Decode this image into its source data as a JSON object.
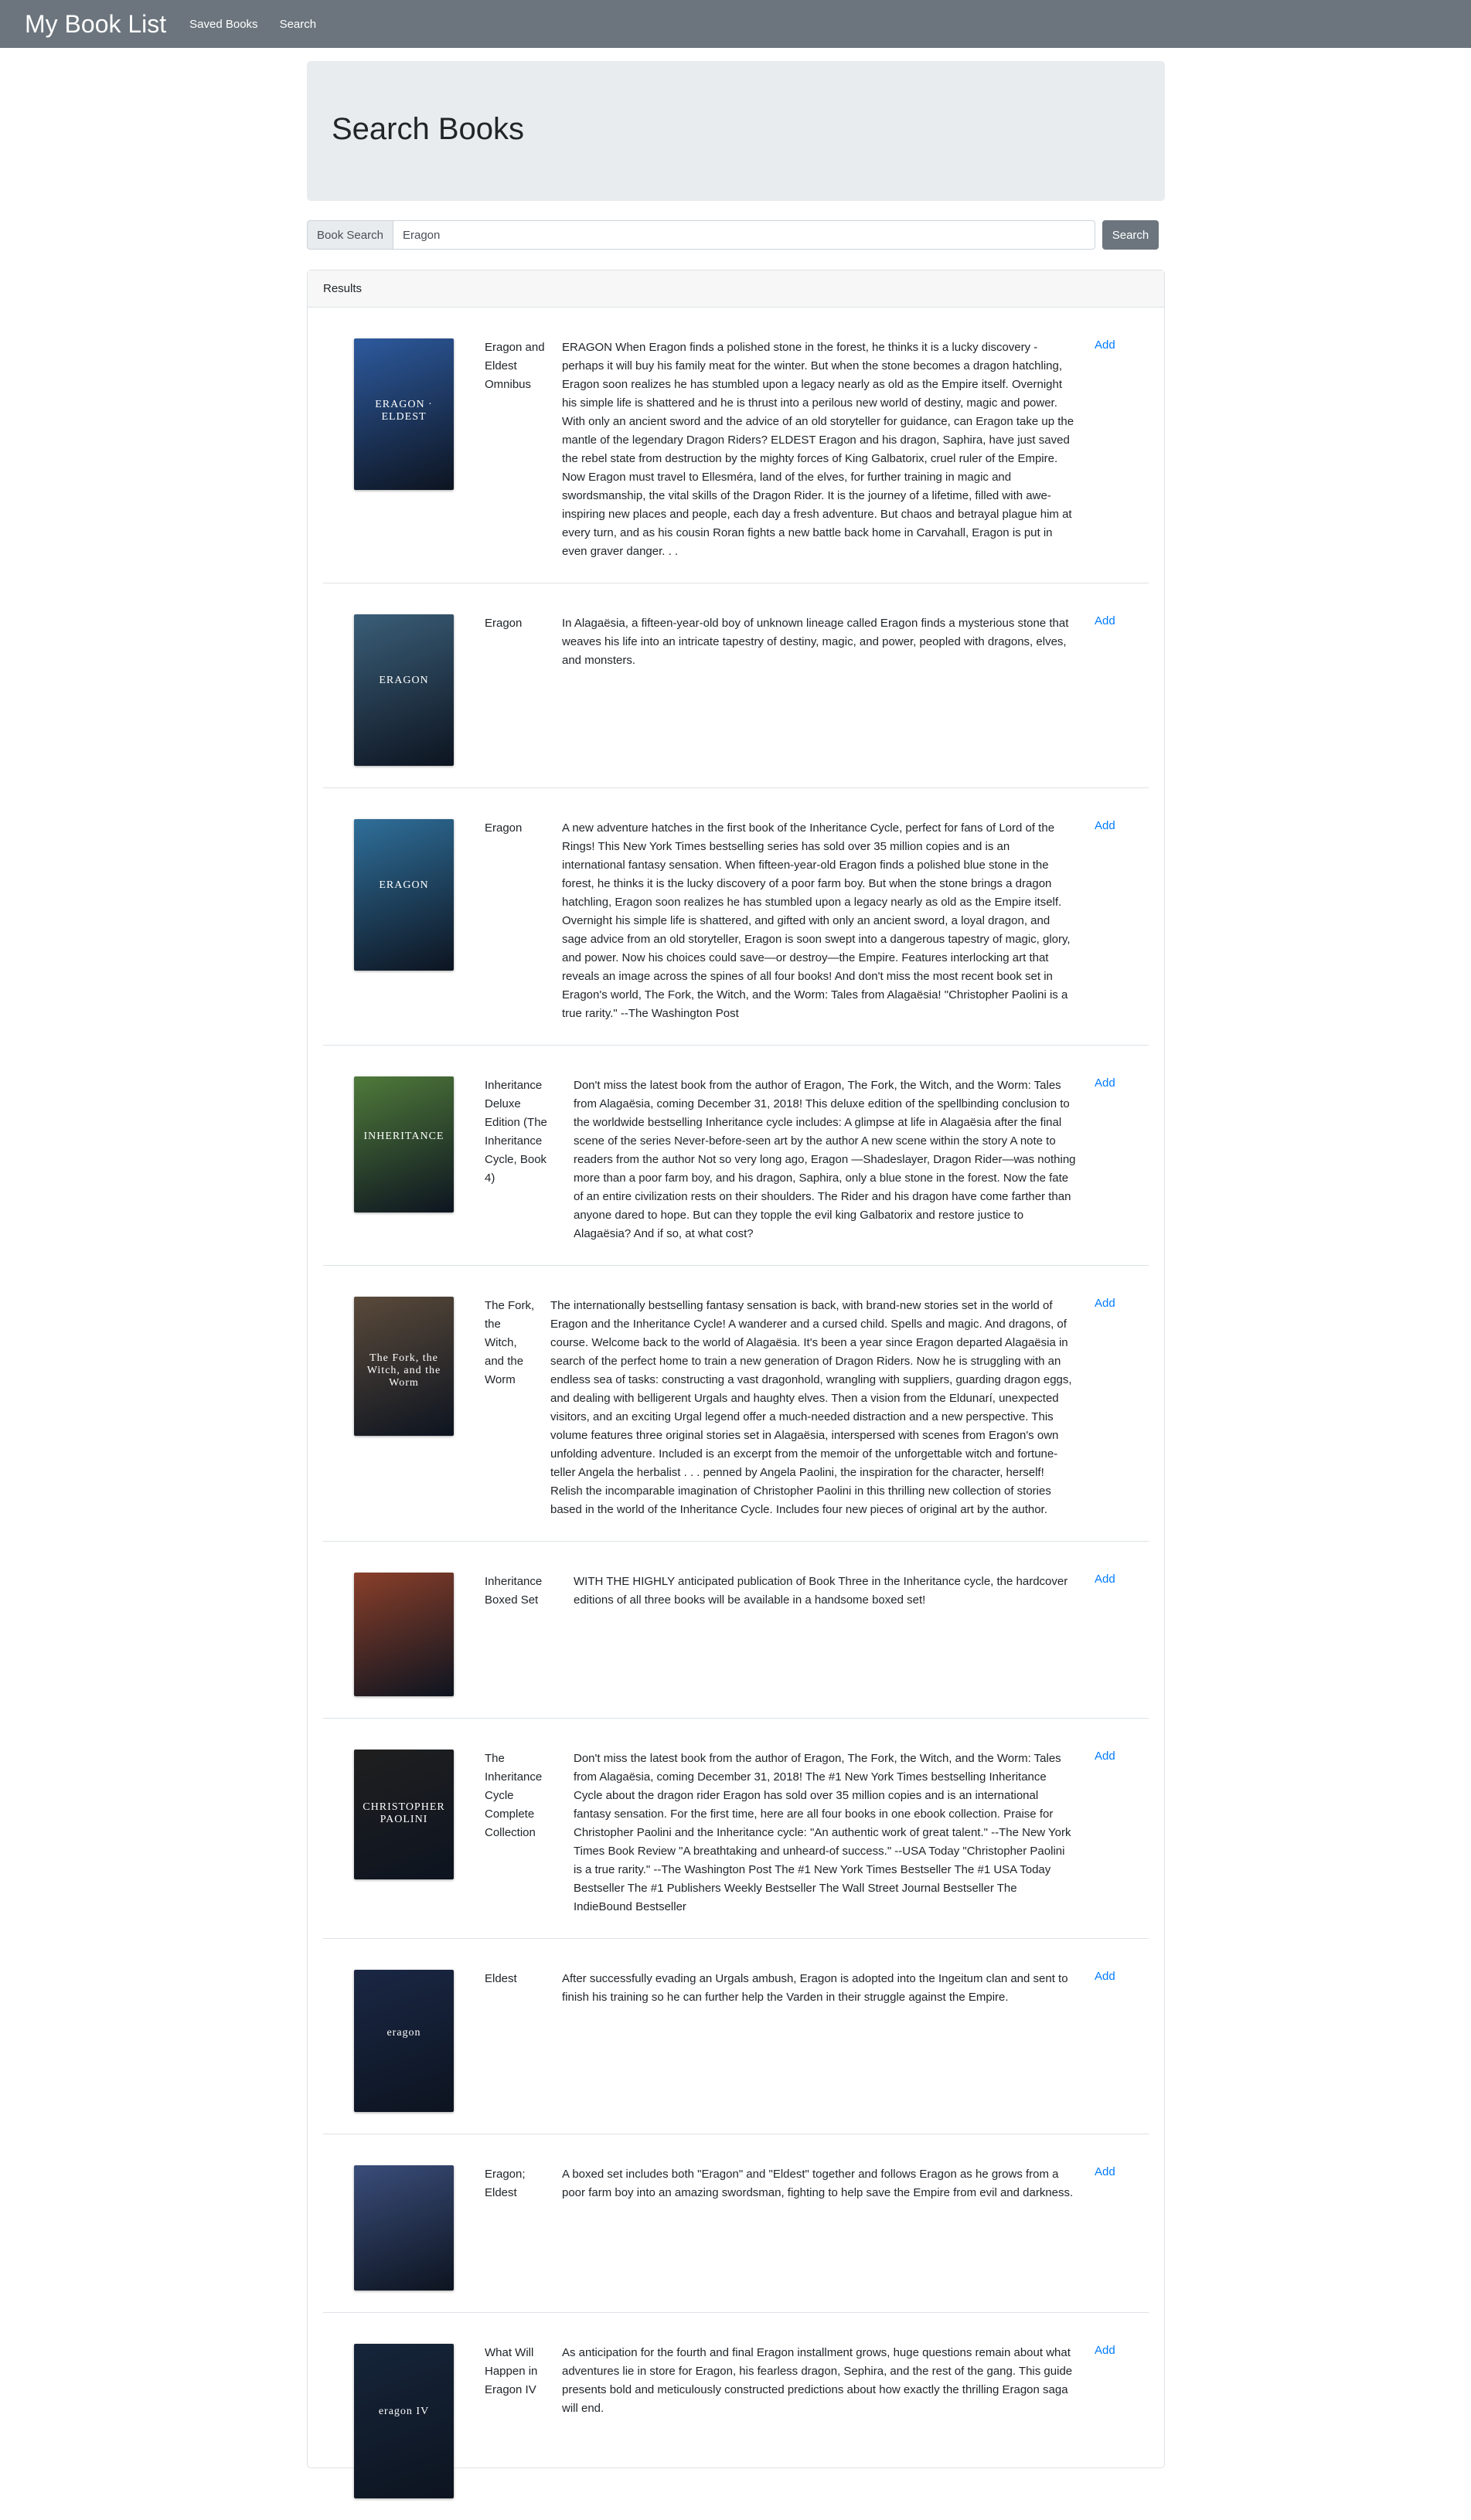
{
  "nav": {
    "brand": "My Book List",
    "links": [
      "Saved Books",
      "Search"
    ]
  },
  "header": {
    "title": "Search Books"
  },
  "search": {
    "label": "Book Search",
    "value": "Eragon",
    "button": "Search"
  },
  "results": {
    "header": "Results",
    "add_label": "Add",
    "items": [
      {
        "title": "Eragon and Eldest Omnibus",
        "cover": {
          "bg": "#2d5a9e",
          "text": "ERAGON · ELDEST"
        },
        "description": "ERAGON When Eragon finds a polished stone in the forest, he thinks it is a lucky discovery - perhaps it will buy his family meat for the winter. But when the stone becomes a dragon hatchling, Eragon soon realizes he has stumbled upon a legacy nearly as old as the Empire itself. Overnight his simple life is shattered and he is thrust into a perilous new world of destiny, magic and power. With only an ancient sword and the advice of an old storyteller for guidance, can Eragon take up the mantle of the legendary Dragon Riders? ELDEST Eragon and his dragon, Saphira, have just saved the rebel state from destruction by the mighty forces of King Galbatorix, cruel ruler of the Empire. Now Eragon must travel to Ellesméra, land of the elves, for further training in magic and swordsmanship, the vital skills of the Dragon Rider. It is the journey of a lifetime, filled with awe-inspiring new places and people, each day a fresh adventure. But chaos and betrayal plague him at every turn, and as his cousin Roran fights a new battle back home in Carvahall, Eragon is put in even graver danger. . ."
      },
      {
        "title": "Eragon",
        "cover": {
          "bg": "#3a5e78",
          "text": "ERAGON"
        },
        "description": "In Alagaësia, a fifteen-year-old boy of unknown lineage called Eragon finds a mysterious stone that weaves his life into an intricate tapestry of destiny, magic, and power, peopled with dragons, elves, and monsters."
      },
      {
        "title": "Eragon",
        "cover": {
          "bg": "#2f6f9a",
          "text": "ERAGON"
        },
        "description": "A new adventure hatches in the first book of the Inheritance Cycle, perfect for fans of Lord of the Rings! This New York Times bestselling series has sold over 35 million copies and is an international fantasy sensation. When fifteen-year-old Eragon finds a polished blue stone in the forest, he thinks it is the lucky discovery of a poor farm boy. But when the stone brings a dragon hatchling, Eragon soon realizes he has stumbled upon a legacy nearly as old as the Empire itself. Overnight his simple life is shattered, and gifted with only an ancient sword, a loyal dragon, and sage advice from an old storyteller, Eragon is soon swept into a dangerous tapestry of magic, glory, and power. Now his choices could save—or destroy—the Empire. Features interlocking art that reveals an image across the spines of all four books! And don't miss the most recent book set in Eragon's world, The Fork, the Witch, and the Worm: Tales from Alagaësia! \"Christopher Paolini is a true rarity.\" --The Washington Post"
      },
      {
        "title": "Inheritance Deluxe Edition (The Inheritance Cycle, Book 4)",
        "cover": {
          "bg": "#4f7a3a",
          "text": "INHERITANCE"
        },
        "description": "Don't miss the latest book from the author of Eragon, The Fork, the Witch, and the Worm: Tales from Alagaësia, coming December 31, 2018! This deluxe edition of the spellbinding conclusion to the worldwide bestselling Inheritance cycle includes: A glimpse at life in Alagaësia after the final scene of the series Never-before-seen art by the author A new scene within the story A note to readers from the author Not so very long ago, Eragon —Shadeslayer, Dragon Rider—was nothing more than a poor farm boy, and his dragon, Saphira, only a blue stone in the forest. Now the fate of an entire civilization rests on their shoulders. The Rider and his dragon have come farther than anyone dared to hope. But can they topple the evil king Galbatorix and restore justice to Alagaësia? And if so, at what cost?"
      },
      {
        "title": "The Fork, the Witch, and the Worm",
        "cover": {
          "bg": "#5a4a3a",
          "text": "The Fork, the Witch, and the Worm"
        },
        "description": "The internationally bestselling fantasy sensation is back, with brand-new stories set in the world of Eragon and the Inheritance Cycle! A wanderer and a cursed child. Spells and magic. And dragons, of course. Welcome back to the world of Alagaësia. It's been a year since Eragon departed Alagaësia in search of the perfect home to train a new generation of Dragon Riders. Now he is struggling with an endless sea of tasks: constructing a vast dragonhold, wrangling with suppliers, guarding dragon eggs, and dealing with belligerent Urgals and haughty elves. Then a vision from the Eldunarí, unexpected visitors, and an exciting Urgal legend offer a much-needed distraction and a new perspective. This volume features three original stories set in Alagaësia, interspersed with scenes from Eragon's own unfolding adventure. Included is an excerpt from the memoir of the unforgettable witch and fortune-teller Angela the herbalist . . . penned by Angela Paolini, the inspiration for the character, herself! Relish the incomparable imagination of Christopher Paolini in this thrilling new collection of stories based in the world of the Inheritance Cycle. Includes four new pieces of original art by the author."
      },
      {
        "title": "Inheritance Boxed Set",
        "cover": {
          "bg": "#8a3f2a",
          "text": ""
        },
        "description": "WITH THE HIGHLY anticipated publication of Book Three in the Inheritance cycle, the hardcover editions of all three books will be available in a handsome boxed set!"
      },
      {
        "title": "The Inheritance Cycle Complete Collection",
        "cover": {
          "bg": "#1f1f1f",
          "text": "CHRISTOPHER PAOLINI"
        },
        "description": "Don't miss the latest book from the author of Eragon, The Fork, the Witch, and the Worm: Tales from Alagaësia, coming December 31, 2018! The #1 New York Times bestselling Inheritance Cycle about the dragon rider Eragon has sold over 35 million copies and is an international fantasy sensation. For the first time, here are all four books in one ebook collection. Praise for Christopher Paolini and the Inheritance cycle: \"An authentic work of great talent.\" --The New York Times Book Review \"A breathtaking and unheard-of success.\" --USA Today \"Christopher Paolini is a true rarity.\" --The Washington Post The #1 New York Times Bestseller The #1 USA Today Bestseller The #1 Publishers Weekly Bestseller The Wall Street Journal Bestseller The IndieBound Bestseller"
      },
      {
        "title": "Eldest",
        "cover": {
          "bg": "#1a2744",
          "text": "eragon"
        },
        "description": "After successfully evading an Urgals ambush, Eragon is adopted into the Ingeitum clan and sent to finish his training so he can further help the Varden in their struggle against the Empire."
      },
      {
        "title": "Eragon; Eldest",
        "cover": {
          "bg": "#3a4d7a",
          "text": ""
        },
        "description": "A boxed set includes both \"Eragon\" and \"Eldest\" together and follows Eragon as he grows from a poor farm boy into an amazing swordsman, fighting to help save the Empire from evil and darkness."
      },
      {
        "title": "What Will Happen in Eragon IV",
        "cover": {
          "bg": "#16253a",
          "text": "eragon IV"
        },
        "description": "As anticipation for the fourth and final Eragon installment grows, huge questions remain about what adventures lie in store for Eragon, his fearless dragon, Sephira, and the rest of the gang. This guide presents bold and meticulously constructed predictions about how exactly the thrilling Eragon saga will end."
      }
    ]
  }
}
